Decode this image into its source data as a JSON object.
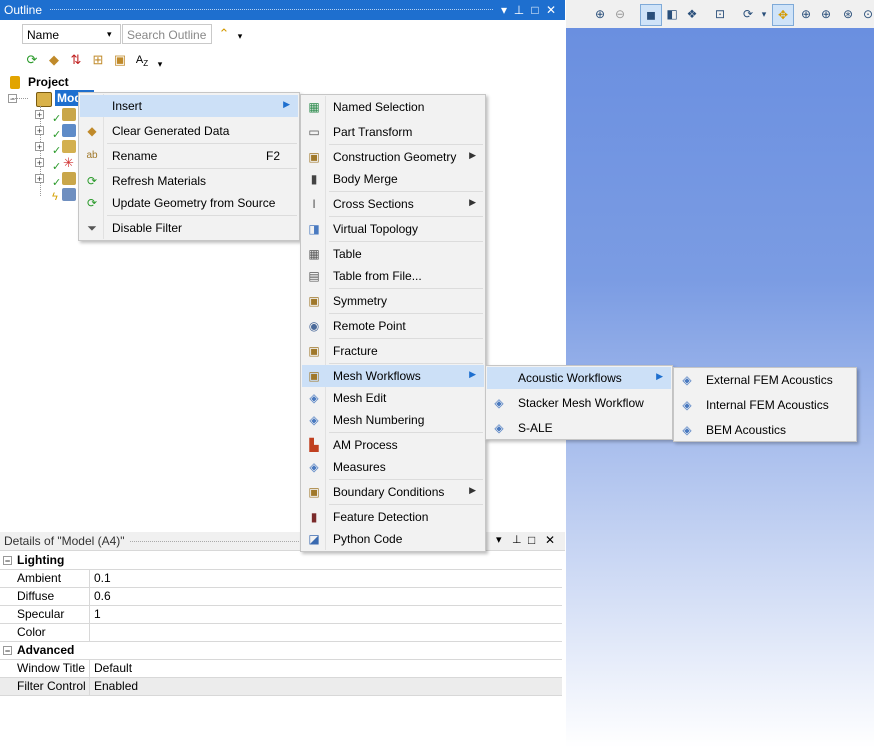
{
  "outline": {
    "title": "Outline",
    "filter_combo": "Name",
    "search_placeholder": "Search Outline",
    "tree": {
      "project": "Project",
      "model": "Model"
    }
  },
  "context_menu": {
    "items": [
      {
        "label": "Insert",
        "has_submenu": true
      },
      {
        "label": "Clear Generated Data"
      },
      {
        "label": "Rename",
        "shortcut": "F2"
      },
      {
        "label": "Refresh Materials"
      },
      {
        "label": "Update Geometry from Source"
      },
      {
        "label": "Disable Filter"
      }
    ]
  },
  "insert_menu": {
    "items": [
      {
        "label": "Named Selection"
      },
      {
        "label": "Part Transform"
      },
      {
        "label": "Construction Geometry",
        "has_submenu": true
      },
      {
        "label": "Body Merge"
      },
      {
        "label": "Cross Sections",
        "has_submenu": true
      },
      {
        "label": "Virtual Topology"
      },
      {
        "label": "Table"
      },
      {
        "label": "Table from File..."
      },
      {
        "label": "Symmetry"
      },
      {
        "label": "Remote Point"
      },
      {
        "label": "Fracture"
      },
      {
        "label": "Mesh Workflows",
        "has_submenu": true
      },
      {
        "label": "Mesh Edit"
      },
      {
        "label": "Mesh Numbering"
      },
      {
        "label": "AM Process"
      },
      {
        "label": "Measures"
      },
      {
        "label": "Boundary Conditions",
        "has_submenu": true
      },
      {
        "label": "Feature Detection"
      },
      {
        "label": "Python Code"
      }
    ]
  },
  "mesh_workflows_menu": {
    "items": [
      {
        "label": "Acoustic Workflows",
        "has_submenu": true
      },
      {
        "label": "Stacker Mesh Workflow"
      },
      {
        "label": "S-ALE"
      }
    ]
  },
  "acoustic_menu": {
    "items": [
      {
        "label": "External FEM Acoustics"
      },
      {
        "label": "Internal FEM Acoustics"
      },
      {
        "label": "BEM Acoustics"
      }
    ]
  },
  "details": {
    "title": "Details of \"Model (A4)\"",
    "categories": [
      {
        "name": "Lighting",
        "rows": [
          {
            "label": "Ambient",
            "value": "0.1"
          },
          {
            "label": "Diffuse",
            "value": "0.6"
          },
          {
            "label": "Specular",
            "value": "1"
          },
          {
            "label": "Color",
            "value": ""
          }
        ]
      },
      {
        "name": "Advanced",
        "rows": [
          {
            "label": "Window Title",
            "value": "Default"
          },
          {
            "label": "Filter Control",
            "value": "Enabled"
          }
        ]
      }
    ]
  },
  "colors": {
    "titlebar": "#1e6fcf",
    "menu_highlight": "#cce0f7",
    "viewport_top": "#6a8fe0"
  }
}
